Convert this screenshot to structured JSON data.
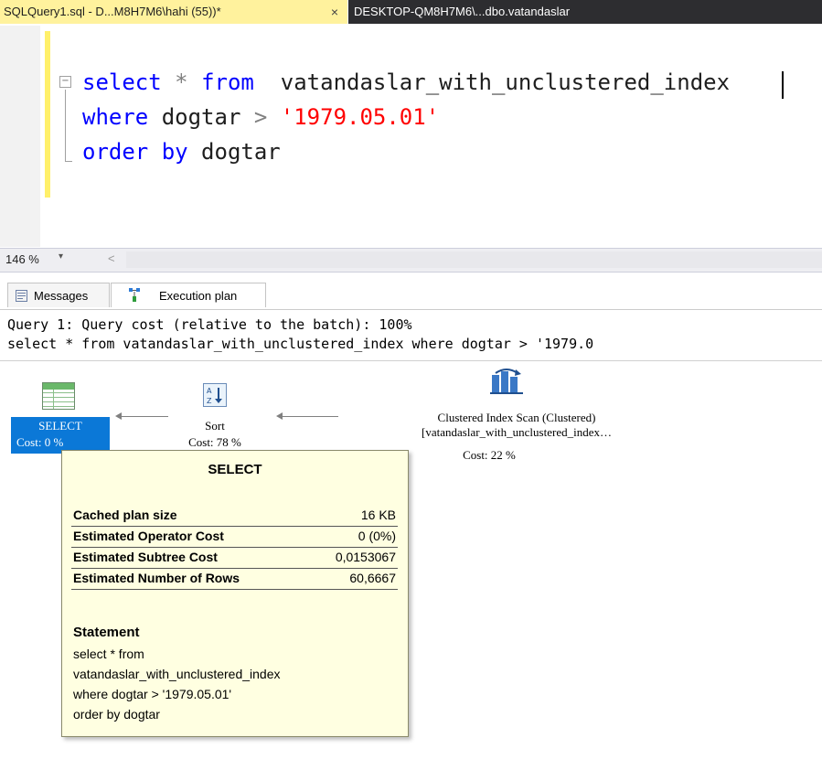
{
  "tabs": {
    "active": {
      "label": "SQLQuery1.sql - D...M8H7M6\\hahi (55))*",
      "close": "×"
    },
    "inactive": {
      "label": "DESKTOP-QM8H7M6\\...dbo.vatandaslar"
    }
  },
  "editor": {
    "line1": {
      "kw1": "select",
      "star": "*",
      "kw2": "from",
      "table": "vatandaslar_with_unclustered_index"
    },
    "line2": {
      "kw": "where",
      "col": "dogtar",
      "op": ">",
      "str": "'1979.05.01'"
    },
    "line3": {
      "kw": "order by",
      "col": "dogtar"
    },
    "fold_toggle": "−"
  },
  "zoom": {
    "value": "146 %",
    "dropdown": "▾",
    "scroll_left": "<"
  },
  "result_tabs": {
    "messages": "Messages",
    "execution_plan": "Execution plan"
  },
  "plan_header": {
    "line1": "Query 1: Query cost (relative to the batch): 100%",
    "line2": "select * from vatandaslar_with_unclustered_index where dogtar > '1979.0"
  },
  "plan": {
    "select": {
      "label": "SELECT",
      "cost": "Cost: 0 %"
    },
    "sort": {
      "label": "Sort",
      "cost": "Cost: 78 %"
    },
    "scan": {
      "label": "Clustered Index Scan (Clustered)",
      "object": "[vatandaslar_with_unclustered_index…",
      "cost": "Cost: 22 %"
    }
  },
  "tooltip": {
    "title": "SELECT",
    "rows": [
      {
        "key": "Cached plan size",
        "value": "16 KB"
      },
      {
        "key": "Estimated Operator Cost",
        "value": "0 (0%)"
      },
      {
        "key": "Estimated Subtree Cost",
        "value": "0,0153067"
      },
      {
        "key": "Estimated Number of Rows",
        "value": "60,6667"
      }
    ],
    "statement_title": "Statement",
    "statement_lines": [
      "select * from",
      "vatandaslar_with_unclustered_index",
      "where dogtar > '1979.05.01'",
      "order by dogtar"
    ]
  },
  "colors": {
    "active_tab": "#fff29d",
    "inactive_tab": "#2d2d30",
    "keyword": "#0000ff",
    "string": "#ff0000",
    "selection": "#0b78d7",
    "tooltip_bg": "#ffffe1"
  }
}
